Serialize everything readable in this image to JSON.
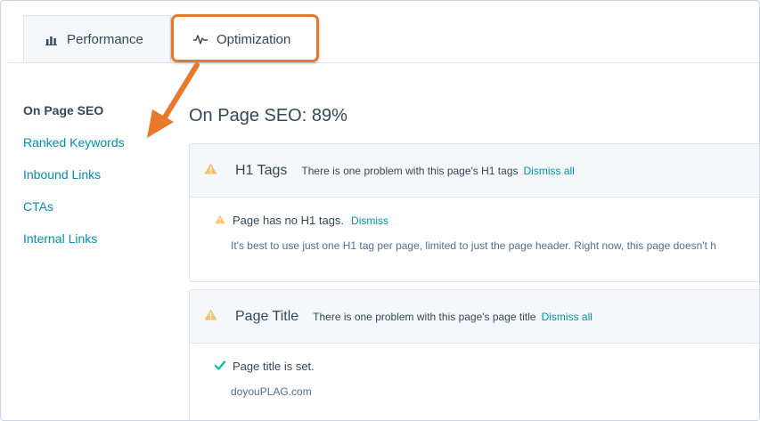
{
  "tabs": [
    {
      "label": "Performance",
      "icon": "bar-chart-icon"
    },
    {
      "label": "Optimization",
      "icon": "pulse-icon"
    }
  ],
  "colors": {
    "accent": "#0091ae",
    "highlight": "#e8792b",
    "warning": "#f5c26b",
    "success": "#00bda5"
  },
  "sidebar": {
    "items": [
      {
        "label": "On Page SEO"
      },
      {
        "label": "Ranked Keywords"
      },
      {
        "label": "Inbound Links"
      },
      {
        "label": "CTAs"
      },
      {
        "label": "Internal Links"
      }
    ]
  },
  "main": {
    "title": "On Page SEO: 89%",
    "sections": [
      {
        "title": "H1 Tags",
        "summary": "There is one problem with this page's H1 tags",
        "dismiss_all": "Dismiss all",
        "issue_text": "Page has no H1 tags.",
        "issue_action": "Dismiss",
        "issue_description": "It's best to use just one H1 tag per page, limited to just the page header. Right now, this page doesn't h"
      },
      {
        "title": "Page Title",
        "summary": "There is one problem with this page's page title",
        "dismiss_all": "Dismiss all",
        "issue_text": "Page title is set.",
        "issue_description": "doyouPLAG.com"
      }
    ]
  }
}
